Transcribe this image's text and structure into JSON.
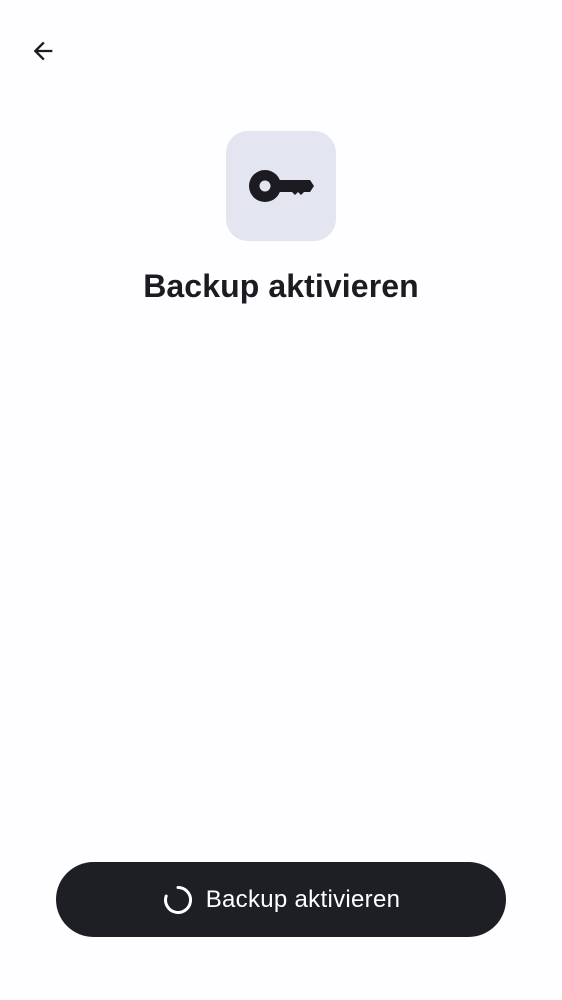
{
  "header": {
    "back_icon": "arrow-left-icon"
  },
  "hero": {
    "icon": "key-icon",
    "icon_background": "#e3e5f0",
    "title": "Backup aktivieren"
  },
  "footer": {
    "button_label": "Backup aktivieren",
    "button_background": "#1e1f25",
    "loading_icon": "spinner-icon",
    "is_loading": true
  }
}
